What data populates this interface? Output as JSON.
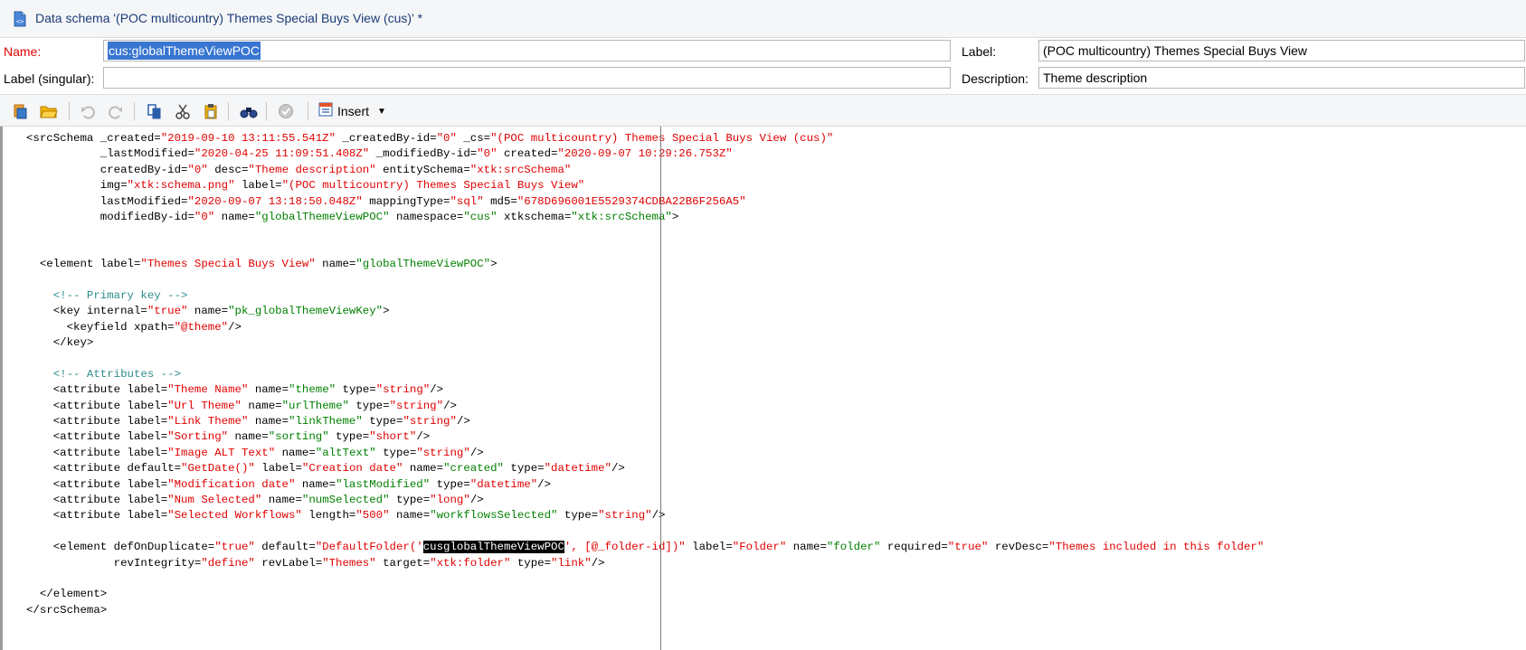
{
  "window": {
    "title": "Data schema '(POC multicountry) Themes Special Buys View (cus)' *"
  },
  "form": {
    "name_label": "Name:",
    "name_value": "cus:globalThemeViewPOC",
    "label_label": "Label:",
    "label_value": "(POC multicountry) Themes Special Buys View",
    "label_singular_label": "Label (singular):",
    "label_singular_value": "",
    "description_label": "Description:",
    "description_value": "Theme description"
  },
  "toolbar": {
    "insert_label": "Insert",
    "icons": [
      "new-schema-icon",
      "open-folder-icon",
      "undo-icon",
      "redo-icon",
      "copy-icon",
      "cut-icon",
      "paste-icon",
      "find-icon",
      "check-icon",
      "insert-icon"
    ]
  },
  "editor": {
    "lines": [
      [
        [
          "t",
          "<srcSchema _created="
        ],
        [
          "v",
          "\"2019-09-10 13:11:55.541Z\""
        ],
        [
          "t",
          " _createdBy-id="
        ],
        [
          "v",
          "\"0\""
        ],
        [
          "t",
          " _cs="
        ],
        [
          "v",
          "\"(POC multicountry) Themes Special Buys View (cus)\""
        ]
      ],
      [
        [
          "t",
          "           _lastModified="
        ],
        [
          "v",
          "\"2020-04-25 11:09:51.408Z\""
        ],
        [
          "t",
          " _modifiedBy-id="
        ],
        [
          "v",
          "\"0\""
        ],
        [
          "t",
          " created="
        ],
        [
          "v",
          "\"2020-09-07 10:29:26.753Z\""
        ]
      ],
      [
        [
          "t",
          "           createdBy-id="
        ],
        [
          "v",
          "\"0\""
        ],
        [
          "t",
          " desc="
        ],
        [
          "v",
          "\"Theme description\""
        ],
        [
          "t",
          " entitySchema="
        ],
        [
          "v",
          "\"xtk:srcSchema\""
        ]
      ],
      [
        [
          "t",
          "           img="
        ],
        [
          "v",
          "\"xtk:schema.png\""
        ],
        [
          "t",
          " label="
        ],
        [
          "v",
          "\"(POC multicountry) Themes Special Buys View\""
        ]
      ],
      [
        [
          "t",
          "           lastModified="
        ],
        [
          "v",
          "\"2020-09-07 13:18:50.048Z\""
        ],
        [
          "t",
          " mappingType="
        ],
        [
          "v",
          "\"sql\""
        ],
        [
          "t",
          " md5="
        ],
        [
          "v",
          "\"678D696001E5529374CDBA22B6F256A5\""
        ]
      ],
      [
        [
          "t",
          "           modifiedBy-id="
        ],
        [
          "v",
          "\"0\""
        ],
        [
          "t",
          " name="
        ],
        [
          "n",
          "\"globalThemeViewPOC\""
        ],
        [
          "t",
          " namespace="
        ],
        [
          "n",
          "\"cus\""
        ],
        [
          "t",
          " xtkschema="
        ],
        [
          "n",
          "\"xtk:srcSchema\""
        ],
        [
          "t",
          ">"
        ]
      ],
      [],
      [],
      [
        [
          "t",
          "  <element label="
        ],
        [
          "v",
          "\"Themes Special Buys View\""
        ],
        [
          "t",
          " name="
        ],
        [
          "n",
          "\"globalThemeViewPOC\""
        ],
        [
          "t",
          ">"
        ]
      ],
      [],
      [
        [
          "c",
          "    <!-- Primary key -->"
        ]
      ],
      [
        [
          "t",
          "    <key internal="
        ],
        [
          "v",
          "\"true\""
        ],
        [
          "t",
          " name="
        ],
        [
          "n",
          "\"pk_globalThemeViewKey\""
        ],
        [
          "t",
          ">"
        ]
      ],
      [
        [
          "t",
          "      <keyfield xpath="
        ],
        [
          "v",
          "\"@theme\""
        ],
        [
          "t",
          "/>"
        ]
      ],
      [
        [
          "t",
          "    </key>"
        ]
      ],
      [],
      [
        [
          "c",
          "    <!-- Attributes -->"
        ]
      ],
      [
        [
          "t",
          "    <attribute label="
        ],
        [
          "v",
          "\"Theme Name\""
        ],
        [
          "t",
          " name="
        ],
        [
          "n",
          "\"theme\""
        ],
        [
          "t",
          " type="
        ],
        [
          "v",
          "\"string\""
        ],
        [
          "t",
          "/>"
        ]
      ],
      [
        [
          "t",
          "    <attribute label="
        ],
        [
          "v",
          "\"Url Theme\""
        ],
        [
          "t",
          " name="
        ],
        [
          "n",
          "\"urlTheme\""
        ],
        [
          "t",
          " type="
        ],
        [
          "v",
          "\"string\""
        ],
        [
          "t",
          "/>"
        ]
      ],
      [
        [
          "t",
          "    <attribute label="
        ],
        [
          "v",
          "\"Link Theme\""
        ],
        [
          "t",
          " name="
        ],
        [
          "n",
          "\"linkTheme\""
        ],
        [
          "t",
          " type="
        ],
        [
          "v",
          "\"string\""
        ],
        [
          "t",
          "/>"
        ]
      ],
      [
        [
          "t",
          "    <attribute label="
        ],
        [
          "v",
          "\"Sorting\""
        ],
        [
          "t",
          " name="
        ],
        [
          "n",
          "\"sorting\""
        ],
        [
          "t",
          " type="
        ],
        [
          "v",
          "\"short\""
        ],
        [
          "t",
          "/>"
        ]
      ],
      [
        [
          "t",
          "    <attribute label="
        ],
        [
          "v",
          "\"Image ALT Text\""
        ],
        [
          "t",
          " name="
        ],
        [
          "n",
          "\"altText\""
        ],
        [
          "t",
          " type="
        ],
        [
          "v",
          "\"string\""
        ],
        [
          "t",
          "/>"
        ]
      ],
      [
        [
          "t",
          "    <attribute default="
        ],
        [
          "v",
          "\"GetDate()\""
        ],
        [
          "t",
          " label="
        ],
        [
          "v",
          "\"Creation date\""
        ],
        [
          "t",
          " name="
        ],
        [
          "n",
          "\"created\""
        ],
        [
          "t",
          " type="
        ],
        [
          "v",
          "\"datetime\""
        ],
        [
          "t",
          "/>"
        ]
      ],
      [
        [
          "t",
          "    <attribute label="
        ],
        [
          "v",
          "\"Modification date\""
        ],
        [
          "t",
          " name="
        ],
        [
          "n",
          "\"lastModified\""
        ],
        [
          "t",
          " type="
        ],
        [
          "v",
          "\"datetime\""
        ],
        [
          "t",
          "/>"
        ]
      ],
      [
        [
          "t",
          "    <attribute label="
        ],
        [
          "v",
          "\"Num Selected\""
        ],
        [
          "t",
          " name="
        ],
        [
          "n",
          "\"numSelected\""
        ],
        [
          "t",
          " type="
        ],
        [
          "v",
          "\"long\""
        ],
        [
          "t",
          "/>"
        ]
      ],
      [
        [
          "t",
          "    <attribute label="
        ],
        [
          "v",
          "\"Selected Workflows\""
        ],
        [
          "t",
          " length="
        ],
        [
          "v",
          "\"500\""
        ],
        [
          "t",
          " name="
        ],
        [
          "n",
          "\"workflowsSelected\""
        ],
        [
          "t",
          " type="
        ],
        [
          "v",
          "\"string\""
        ],
        [
          "t",
          "/>"
        ]
      ],
      [],
      [
        [
          "t",
          "    <element defOnDuplicate="
        ],
        [
          "v",
          "\"true\""
        ],
        [
          "t",
          " default="
        ],
        [
          "v",
          "\"DefaultFolder('"
        ],
        [
          "h",
          "cusglobalThemeViewPOC"
        ],
        [
          "v",
          "', [@_folder-id])\""
        ],
        [
          "t",
          " label="
        ],
        [
          "v",
          "\"Folder\""
        ],
        [
          "t",
          " name="
        ],
        [
          "n",
          "\"folder\""
        ],
        [
          "t",
          " required="
        ],
        [
          "v",
          "\"true\""
        ],
        [
          "t",
          " revDesc="
        ],
        [
          "v",
          "\"Themes included in this folder\""
        ]
      ],
      [
        [
          "t",
          "             revIntegrity="
        ],
        [
          "v",
          "\"define\""
        ],
        [
          "t",
          " revLabel="
        ],
        [
          "v",
          "\"Themes\""
        ],
        [
          "t",
          " target="
        ],
        [
          "v",
          "\"xtk:folder\""
        ],
        [
          "t",
          " type="
        ],
        [
          "v",
          "\"link\""
        ],
        [
          "t",
          "/>"
        ]
      ],
      [],
      [
        [
          "t",
          "  </element>"
        ]
      ],
      [
        [
          "t",
          "</srcSchema>"
        ]
      ]
    ]
  }
}
